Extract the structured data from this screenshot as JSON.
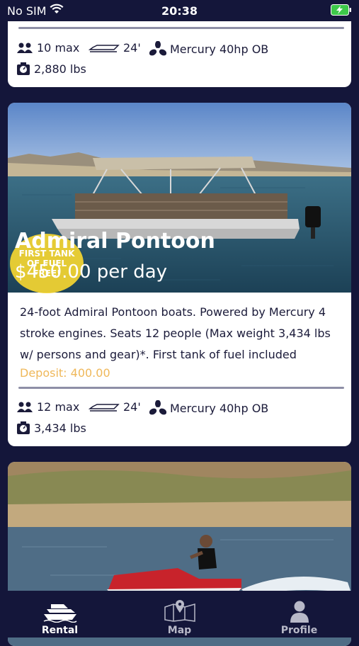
{
  "status_bar": {
    "carrier": "No SIM",
    "time": "20:38"
  },
  "listing_previous": {
    "capacity": "10 max",
    "length": "24'",
    "engine": "Mercury 40hp OB",
    "weight": "2,880 lbs"
  },
  "listing_admiral": {
    "title": "Admiral Pontoon",
    "price": "$... per day",
    "price_visible": "$450.00 per day",
    "badge": "FIRST TANK OF FUEL FREE!",
    "description": "24-foot Admiral Pontoon boats. Powered by Mercury 4 stroke engines. Seats 12 people (Max weight 3,434 lbs w/ persons and gear)*. First tank of fuel included",
    "deposit": "Deposit: 400.00",
    "capacity": "12 max",
    "length": "24'",
    "engine": "Mercury 40hp OB",
    "weight": "3,434 lbs"
  },
  "tabs": [
    {
      "label": "Rental",
      "icon": "boat-icon",
      "active": true
    },
    {
      "label": "Map",
      "icon": "map-icon",
      "active": false
    },
    {
      "label": "Profile",
      "icon": "person-icon",
      "active": false
    }
  ],
  "colors": {
    "background": "#14163a",
    "deposit": "#efb85a",
    "badge": "#f5d631"
  }
}
